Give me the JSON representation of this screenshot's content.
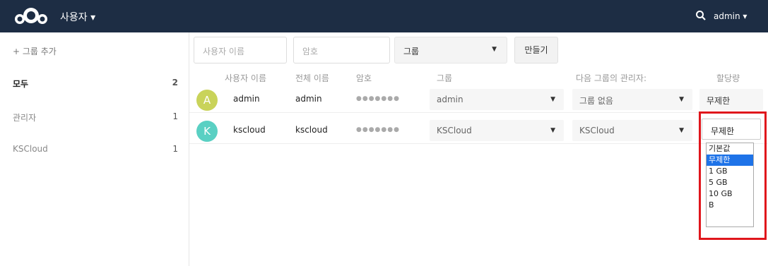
{
  "header": {
    "app_name": "사용자 ▾",
    "user_menu": "admin ▾",
    "logo_icon": "cloud-logo-icon",
    "search_icon": "search-icon",
    "bg_color": "#1d2d44"
  },
  "sidebar": {
    "add_group": "+ 그룹 추가",
    "groups": [
      {
        "label": "모두",
        "count": "2"
      },
      {
        "label": "관리자",
        "count": "1"
      },
      {
        "label": "KSCloud",
        "count": "1"
      }
    ]
  },
  "new_user_form": {
    "username_placeholder": "사용자 이름",
    "password_placeholder": "암호",
    "group_select": "그룹",
    "create_button": "만들기"
  },
  "table": {
    "headers": [
      "사용자 이름",
      "전체 이름",
      "암호",
      "그룹",
      "다음 그룹의 관리자:",
      "할당량"
    ],
    "rows": [
      {
        "avatar_letter": "A",
        "avatar_color": "#c9d35a",
        "username": "admin",
        "fullname": "admin",
        "password": "●●●●●●●",
        "group": "admin",
        "admin_of": "그룹 없음",
        "quota": "무제한"
      },
      {
        "avatar_letter": "K",
        "avatar_color": "#5ad0c3",
        "username": "kscloud",
        "fullname": "kscloud",
        "password": "●●●●●●●",
        "group": "KSCloud",
        "admin_of": "KSCloud",
        "quota": "무제한"
      }
    ]
  },
  "quota_dropdown": {
    "options": [
      "기본값",
      "무제한",
      "1 GB",
      "5 GB",
      "10 GB",
      "B"
    ],
    "selected_index": 1,
    "highlight_color": "#e0161c"
  }
}
